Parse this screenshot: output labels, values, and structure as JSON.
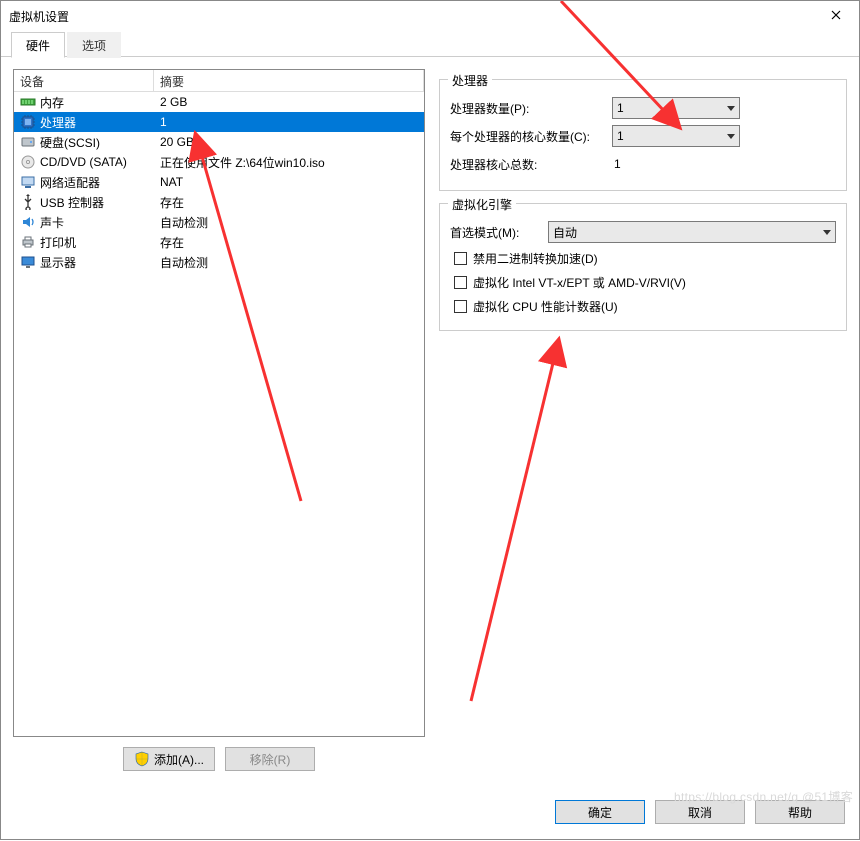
{
  "window": {
    "title": "虚拟机设置"
  },
  "tabs": {
    "hardware": "硬件",
    "options": "选项"
  },
  "hw": {
    "col_device": "设备",
    "col_summary": "摘要",
    "items": [
      {
        "icon": "memory-icon",
        "name": "内存",
        "summary": "2 GB"
      },
      {
        "icon": "cpu-icon",
        "name": "处理器",
        "summary": "1"
      },
      {
        "icon": "disk-icon",
        "name": "硬盘(SCSI)",
        "summary": "20 GB"
      },
      {
        "icon": "disc-icon",
        "name": "CD/DVD (SATA)",
        "summary": "正在使用文件 Z:\\64位win10.iso"
      },
      {
        "icon": "network-icon",
        "name": "网络适配器",
        "summary": "NAT"
      },
      {
        "icon": "usb-icon",
        "name": "USB 控制器",
        "summary": "存在"
      },
      {
        "icon": "sound-icon",
        "name": "声卡",
        "summary": "自动检测"
      },
      {
        "icon": "printer-icon",
        "name": "打印机",
        "summary": "存在"
      },
      {
        "icon": "display-icon",
        "name": "显示器",
        "summary": "自动检测"
      }
    ],
    "add_btn": "添加(A)...",
    "remove_btn": "移除(R)"
  },
  "proc": {
    "legend": "处理器",
    "num_label": "处理器数量(P):",
    "num_value": "1",
    "cores_label": "每个处理器的核心数量(C):",
    "cores_value": "1",
    "total_label": "处理器核心总数:",
    "total_value": "1"
  },
  "virt": {
    "legend": "虚拟化引擎",
    "mode_label": "首选模式(M):",
    "mode_value": "自动",
    "opt_binary": "禁用二进制转换加速(D)",
    "opt_vtx": "虚拟化 Intel VT-x/EPT 或 AMD-V/RVI(V)",
    "opt_perf": "虚拟化 CPU 性能计数器(U)"
  },
  "footer": {
    "ok": "确定",
    "cancel": "取消",
    "help": "帮助"
  },
  "watermark": "https://blog.csdn.net/q @51博客",
  "colors": {
    "selection": "#0078d7",
    "annotation": "#f73131"
  }
}
